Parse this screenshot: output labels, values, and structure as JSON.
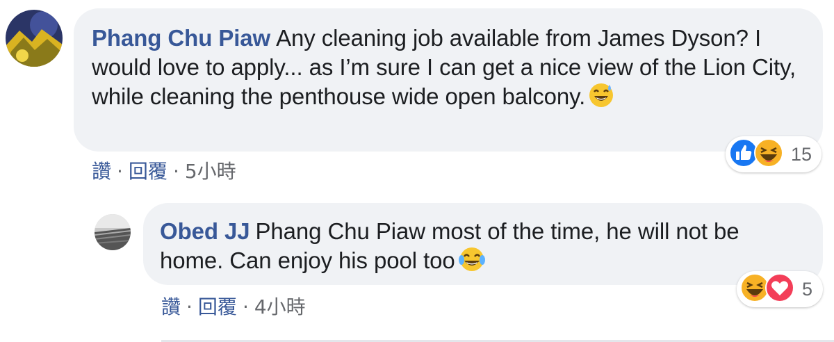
{
  "comments": [
    {
      "author": "Phang Chu Piaw",
      "text": "Any cleaning job available from James Dyson? I would love to apply... as I’m sure I can get a nice view of the Lion City, while cleaning the penthouse wide open balcony.",
      "emoji": "sweat-smile-emoji",
      "actions": {
        "like": "讚",
        "reply": "回覆",
        "sep": "·",
        "time": "5小時"
      },
      "reactions": {
        "icons": [
          "like-icon",
          "haha-icon"
        ],
        "count": "15"
      }
    },
    {
      "author": "Obed JJ",
      "text": "Phang Chu Piaw most of the time, he will not be home. Can enjoy his pool too",
      "emoji": "tears-of-joy-emoji",
      "actions": {
        "like": "讚",
        "reply": "回覆",
        "sep": "·",
        "time": "4小時"
      },
      "reactions": {
        "icons": [
          "haha-icon",
          "love-icon"
        ],
        "count": "5"
      }
    }
  ],
  "colors": {
    "author": "#385898",
    "bubble": "#f0f2f5",
    "text": "#1c1e21",
    "meta": "#65676b",
    "like": "#1877f2",
    "love": "#f33e58",
    "haha": "#f7b125"
  }
}
